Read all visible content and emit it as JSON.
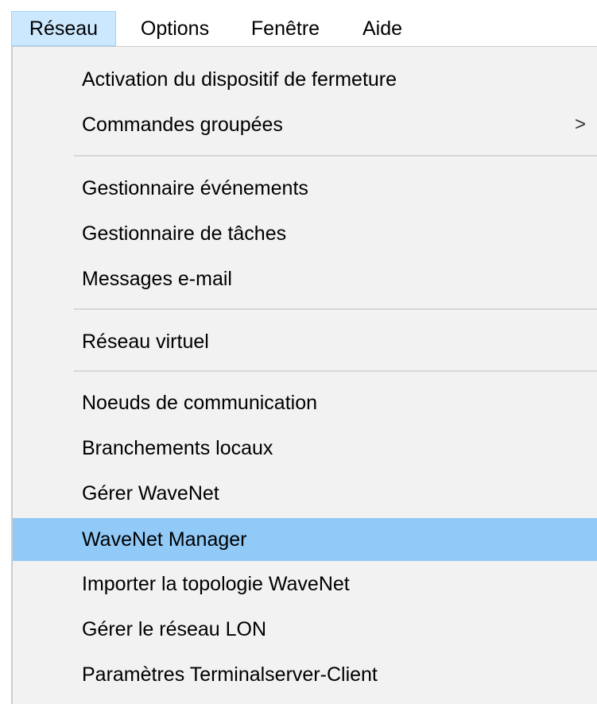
{
  "menubar": {
    "items": [
      "Réseau",
      "Options",
      "Fenêtre",
      "Aide"
    ]
  },
  "menu": {
    "items": [
      {
        "label": "Activation du dispositif de fermeture"
      },
      {
        "label": "Commandes groupées",
        "submenu_indicator": ">"
      },
      {
        "label": "Gestionnaire événements"
      },
      {
        "label": "Gestionnaire de tâches"
      },
      {
        "label": "Messages e-mail"
      },
      {
        "label": "Réseau virtuel"
      },
      {
        "label": "Noeuds de communication"
      },
      {
        "label": "Branchements locaux"
      },
      {
        "label": "Gérer WaveNet"
      },
      {
        "label": "WaveNet Manager",
        "highlighted": true
      },
      {
        "label": "Importer la topologie WaveNet"
      },
      {
        "label": "Gérer le réseau LON"
      },
      {
        "label": "Paramètres Terminalserver-Client"
      }
    ]
  },
  "colors": {
    "menubar_active_bg": "#cce8ff",
    "menu_bg": "#f2f2f2",
    "highlight_bg": "#91c9f7",
    "separator": "#d7d7d7"
  }
}
